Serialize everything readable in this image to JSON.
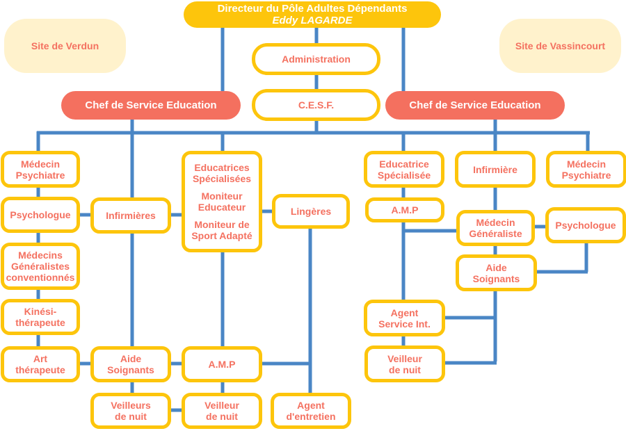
{
  "colors": {
    "director_fill": "#fdc50c",
    "chef_fill": "#f4705f",
    "box_border": "#fdc50c",
    "box_text": "#f47160",
    "site_fill": "#fff2cc",
    "connector": "#4a86c5"
  },
  "director": {
    "title": "Directeur du Pôle Adultes Dépendants",
    "name": "Eddy LAGARDE"
  },
  "sites": {
    "left": "Site de Verdun",
    "right": "Site de Vassincourt"
  },
  "center": {
    "administration": "Administration",
    "cesf": "C.E.S.F."
  },
  "chefs": {
    "left": "Chef de Service Education",
    "right": "Chef de Service Education"
  },
  "verdun": {
    "medecin_psychiatre": [
      "Médecin",
      "Psychiatre"
    ],
    "psychologue": "Psychologue",
    "medecins_generalistes": [
      "Médecins",
      "Généralistes",
      "conventionnés"
    ],
    "kinesitherapeute": [
      "Kinési-",
      "thérapeute"
    ],
    "art_therapeute": [
      "Art",
      "thérapeute"
    ],
    "infirmieres": "Infirmières",
    "aide_soignants": [
      "Aide",
      "Soignants"
    ],
    "veilleurs_de_nuit": [
      "Veilleurs",
      "de nuit"
    ],
    "educ_group": {
      "educatrices": [
        "Educatrices",
        "Spécialisées"
      ],
      "moniteur_educateur": [
        "Moniteur",
        "Educateur"
      ],
      "moniteur_sport": [
        "Moniteur de",
        "Sport Adapté"
      ]
    },
    "amp": "A.M.P",
    "veilleur_de_nuit": [
      "Veilleur",
      "de nuit"
    ],
    "lingeres": "Lingères",
    "agent_entretien": [
      "Agent",
      "d'entretien"
    ]
  },
  "vassincourt": {
    "educatrice": [
      "Educatrice",
      "Spécialisée"
    ],
    "amp": "A.M.P",
    "infirmiere": "Infirmière",
    "medecin_psychiatre": [
      "Médecin",
      "Psychiatre"
    ],
    "medecin_generaliste": [
      "Médecin",
      "Généraliste"
    ],
    "psychologue": "Psychologue",
    "aide_soignants": [
      "Aide",
      "Soignants"
    ],
    "agent_service": [
      "Agent",
      "Service Int."
    ],
    "veilleur_de_nuit": [
      "Veilleur",
      "de nuit"
    ]
  }
}
